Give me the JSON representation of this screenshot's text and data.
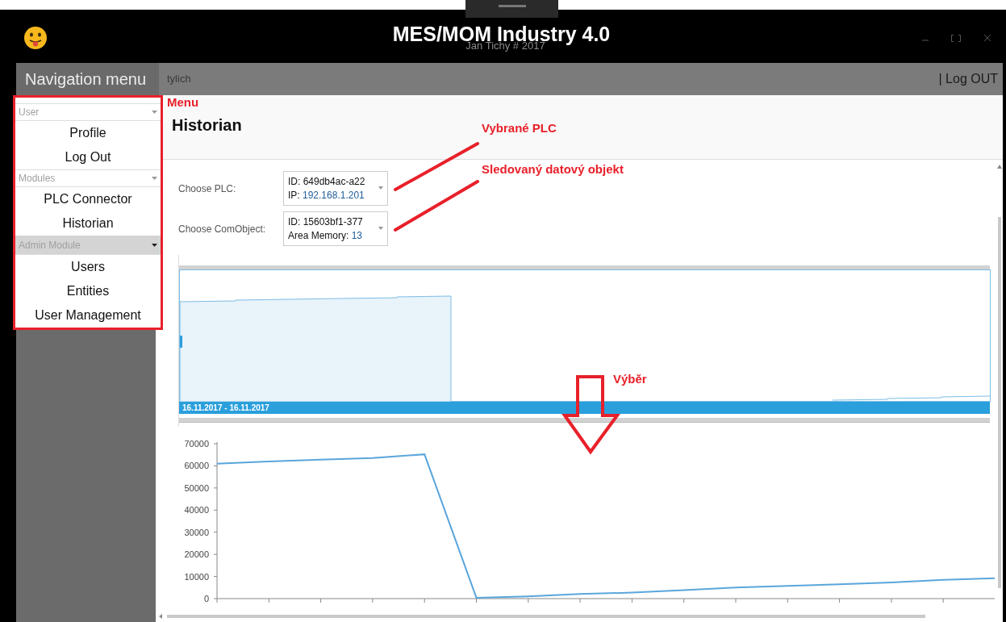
{
  "window": {
    "title": "MES/MOM Industry 4.0",
    "subtitle": "Jan Tichy # 2017"
  },
  "nav_bar": {
    "title": "Navigation menu",
    "user": "tylich",
    "logout": "| Log OUT"
  },
  "sidebar": {
    "groups": [
      {
        "label": "User",
        "highlighted": false,
        "items": [
          "Profile",
          "Log Out"
        ]
      },
      {
        "label": "Modules",
        "highlighted": false,
        "items": [
          "PLC Connector",
          "Historian"
        ]
      },
      {
        "label": "Admin Module",
        "highlighted": true,
        "items": [
          "Users",
          "Entities",
          "User Management"
        ]
      }
    ]
  },
  "page": {
    "title": "Historian"
  },
  "form": [
    {
      "label": "Choose PLC:",
      "line1": "ID: 649db4ac-a22",
      "line2_label": "IP: ",
      "line2_value": "192.168.1.201"
    },
    {
      "label": "Choose ComObject:",
      "line1": "ID: 15603bf1-377",
      "line2_label": "Area Memory: ",
      "line2_value": "13"
    }
  ],
  "navigator": {
    "range": "16.11.2017 - 16.11.2017"
  },
  "chart_data": {
    "type": "line",
    "series": [
      {
        "color": "#5aa6dc",
        "values": [
          61000,
          62000,
          62800,
          63500,
          65200,
          400,
          1000,
          2100,
          2700,
          3800,
          5000,
          5700,
          6500,
          7300,
          8500,
          9200
        ]
      }
    ],
    "ylim": [
      0,
      70000
    ],
    "yticks": [
      0,
      10000,
      20000,
      30000,
      40000,
      50000,
      60000,
      70000
    ]
  },
  "annotations": [
    {
      "text": "Menu"
    },
    {
      "text": "Vybrané PLC"
    },
    {
      "text": "Sledovaný datový objekt"
    },
    {
      "text": "Výběr"
    }
  ]
}
